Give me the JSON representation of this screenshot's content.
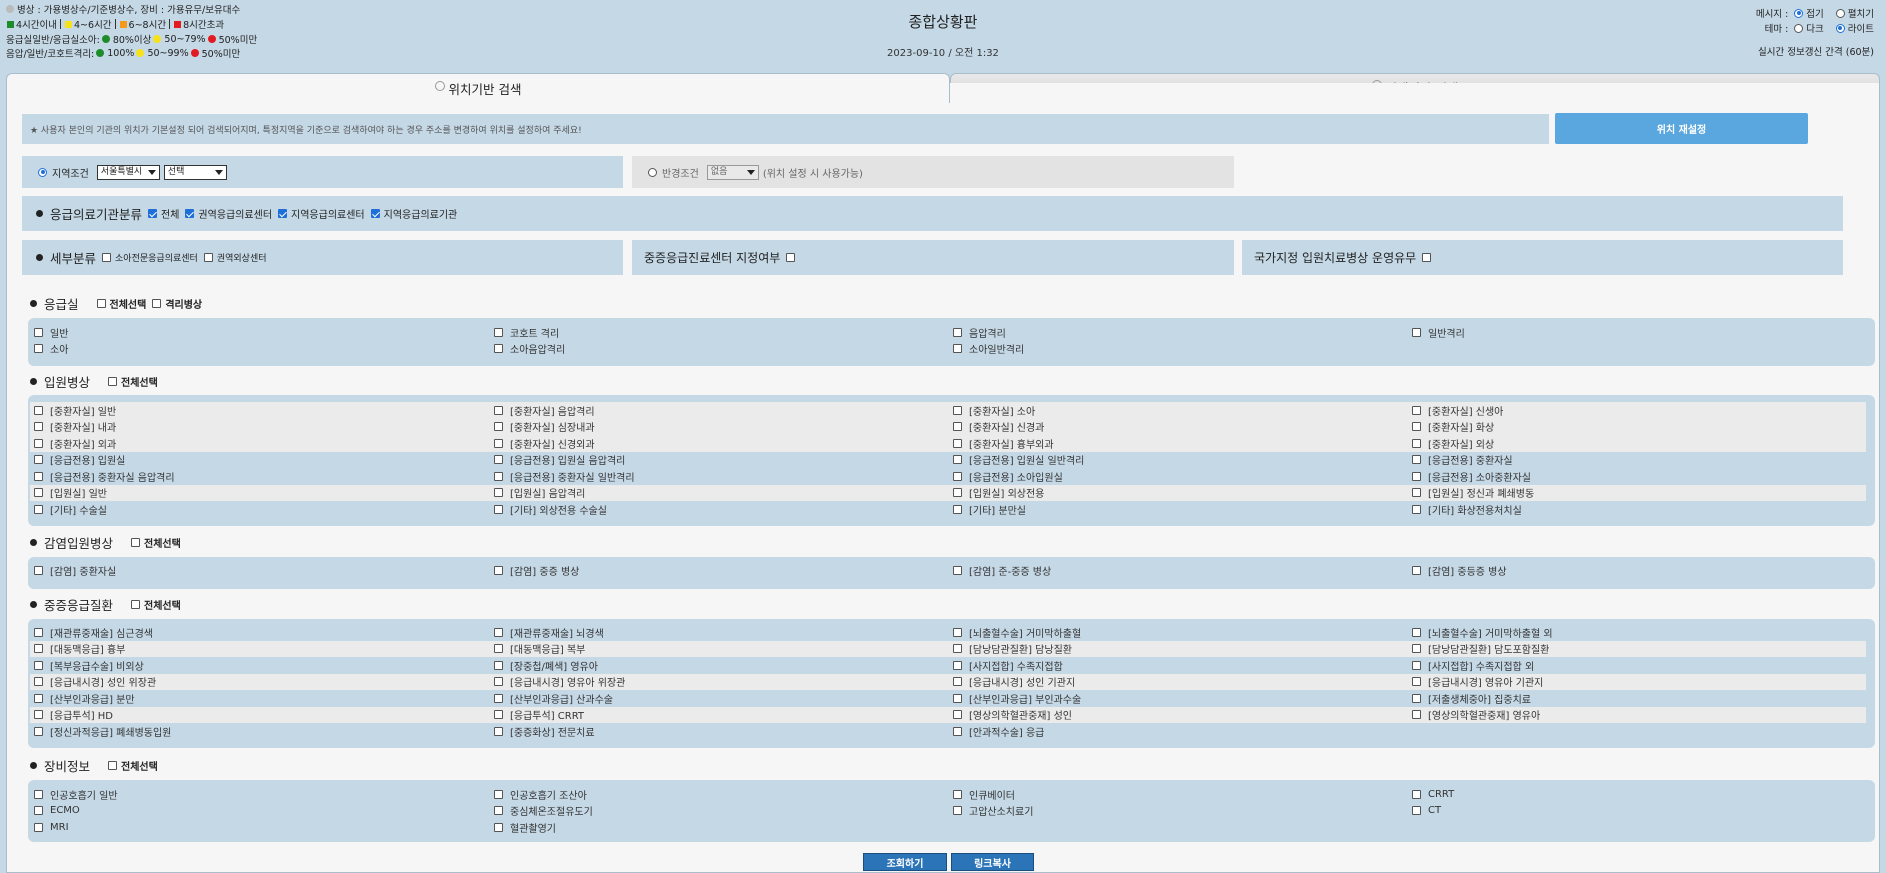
{
  "header": {
    "legend": {
      "line1": "병상 : 가용병상수/기준병상수, 장비 : 가용유무/보유대수",
      "time_items": [
        "4시간이내",
        "4~6시간",
        "6~8시간",
        "8시간초과"
      ],
      "er_label": "응급실일반/응급실소아:",
      "er_items": [
        "80%이상",
        "50~79%",
        "50%미만"
      ],
      "iso_label": "음압/일반/코호트격리:",
      "iso_items": [
        "100%",
        "50~99%",
        "50%미만"
      ]
    },
    "title": "종합상황판",
    "datetime": "2023-09-10 / 오전 1:32",
    "message_label": "메시지 :",
    "message_opts": [
      "접기",
      "펼치기"
    ],
    "theme_label": "테마 :",
    "theme_opts": [
      "다크",
      "라이트"
    ],
    "refresh": "실시간 정보갱신 간격 (60분)"
  },
  "colors": {
    "green": "#1e8c2a",
    "yellow": "#f5e21b",
    "orange": "#f39a1e",
    "red": "#e21b23",
    "blue": "#1e6fd9"
  },
  "tabs": {
    "location": "위치기반 검색",
    "institution": "선택기관 검색"
  },
  "notice": "★ 사용자 본인의 기관의 위치가 기본설정 되어 검색되어지며, 특정지역을 기준으로 검색하여야 하는 경우 주소를 변경하여 위치를 설정하여 주세요!",
  "reset_button": "위치 재설정",
  "region": {
    "label": "지역조건",
    "select1": "서울특별시",
    "select2": "선택"
  },
  "radius": {
    "label": "반경조건",
    "select": "없음",
    "note": "(위치 설정 시 사용가능)"
  },
  "classification": {
    "title": "응급의료기관분류",
    "items": [
      "전체",
      "권역응급의료센터",
      "지역응급의료센터",
      "지역응급의료기관"
    ]
  },
  "subclass": {
    "title": "세부분류",
    "items": [
      "소아전문응급의료센터",
      "권역외상센터"
    ]
  },
  "severe_center": "중증응급진료센터 지정여부",
  "national_bed": "국가지정 입원치료병상 운영유무",
  "er": {
    "title": "응급실",
    "select_all": "전체선택",
    "isolation": "격리병상",
    "items": [
      "일반",
      "코호트 격리",
      "음압격리",
      "일반격리",
      "소아",
      "소아음압격리",
      "소아일반격리"
    ]
  },
  "ward": {
    "title": "입원병상",
    "select_all": "전체선택",
    "items": [
      "[중환자실] 일반",
      "[중환자실] 음압격리",
      "[중환자실] 소아",
      "[중환자실] 신생아",
      "[중환자실] 내과",
      "[중환자실] 심장내과",
      "[중환자실] 신경과",
      "[중환자실] 화상",
      "[중환자실] 외과",
      "[중환자실] 신경외과",
      "[중환자실] 흉부외과",
      "[중환자실] 외상",
      "[응급전용] 입원실",
      "[응급전용] 입원실 음압격리",
      "[응급전용] 입원실 일반격리",
      "[응급전용] 중환자실",
      "[응급전용] 중환자실 음압격리",
      "[응급전용] 중환자실 일반격리",
      "[응급전용] 소아입원실",
      "[응급전용] 소아중환자실",
      "[입원실] 일반",
      "[입원실] 음압격리",
      "[입원실] 외상전용",
      "[입원실] 정신과 폐쇄병동",
      "[기타] 수술실",
      "[기타] 외상전용 수술실",
      "[기타] 분만실",
      "[기타] 화상전용처치실"
    ]
  },
  "infection": {
    "title": "감염입원병상",
    "select_all": "전체선택",
    "items": [
      "[감염] 중환자실",
      "[감염] 중증 병상",
      "[감염] 준-중증 병상",
      "[감염] 중등증 병상"
    ]
  },
  "severe": {
    "title": "중증응급질환",
    "select_all": "전체선택",
    "items": [
      "[재관류중재술] 심근경색",
      "[재관류중재술] 뇌경색",
      "[뇌출혈수술] 거미막하출혈",
      "[뇌출혈수술] 거미막하출혈 외",
      "[대동맥응급] 흉부",
      "[대동맥응급] 복부",
      "[담낭담관질환] 담낭질환",
      "[담낭담관질환] 담도포함질환",
      "[복부응급수술] 비외상",
      "[장중첩/폐색] 영유아",
      "[사지접합] 수족지접합",
      "[사지접합] 수족지접합 외",
      "[응급내시경] 성인 위장관",
      "[응급내시경] 영유아 위장관",
      "[응급내시경] 성인 기관지",
      "[응급내시경] 영유아 기관지",
      "[산부인과응급] 분만",
      "[산부인과응급] 산과수술",
      "[산부인과응급] 부인과수술",
      "[저출생체중아] 집중치료",
      "[응급투석] HD",
      "[응급투석] CRRT",
      "[영상의학혈관중재] 성인",
      "[영상의학혈관중재] 영유아",
      "[정신과적응급] 폐쇄병동입원",
      "[중증화상] 전문치료",
      "[안과적수술] 응급"
    ]
  },
  "equipment": {
    "title": "장비정보",
    "select_all": "전체선택",
    "items": [
      "인공호흡기 일반",
      "인공호흡기 조산아",
      "인큐베이터",
      "CRRT",
      "ECMO",
      "중심체온조절유도기",
      "고압산소치료기",
      "CT",
      "MRI",
      "혈관촬영기"
    ]
  },
  "buttons": {
    "search": "조회하기",
    "copy_link": "링크복사"
  }
}
